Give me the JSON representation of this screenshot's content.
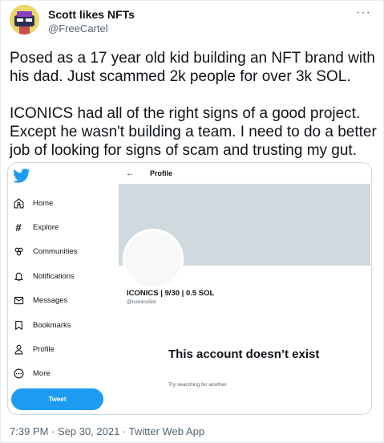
{
  "author": {
    "name": "Scott likes NFTs",
    "handle": "@FreeCartel"
  },
  "tweet": {
    "paragraphs": [
      "Posed as a 17 year old kid building an NFT brand with his dad. Just scammed 2k people for over 3k SOL.",
      "ICONICS had all of the right signs of a good project. Except he wasn't building a team. I need to do a better job of looking for signs of scam and trusting my gut."
    ],
    "timestamp": "7:39 PM · Sep 30, 2021 · Twitter Web App"
  },
  "embed": {
    "sidebar": {
      "items": [
        {
          "label": "Home",
          "icon": "home-icon"
        },
        {
          "label": "Explore",
          "icon": "hashtag-icon"
        },
        {
          "label": "Communities",
          "icon": "communities-icon"
        },
        {
          "label": "Notifications",
          "icon": "bell-icon"
        },
        {
          "label": "Messages",
          "icon": "envelope-icon"
        },
        {
          "label": "Bookmarks",
          "icon": "bookmark-icon"
        },
        {
          "label": "Profile",
          "icon": "person-icon"
        },
        {
          "label": "More",
          "icon": "more-circle-icon"
        }
      ],
      "tweet_button": "Tweet"
    },
    "profile": {
      "header_title": "Profile",
      "display_name": "ICONICS | 9/30 | 0.5 SOL",
      "handle": "@IconicsSol",
      "missing_title": "This account doesn’t exist",
      "missing_hint": "Try searching for another."
    }
  },
  "colors": {
    "accent": "#1d9bf0",
    "banner": "#cfd9de",
    "secondary_text": "#536471"
  }
}
